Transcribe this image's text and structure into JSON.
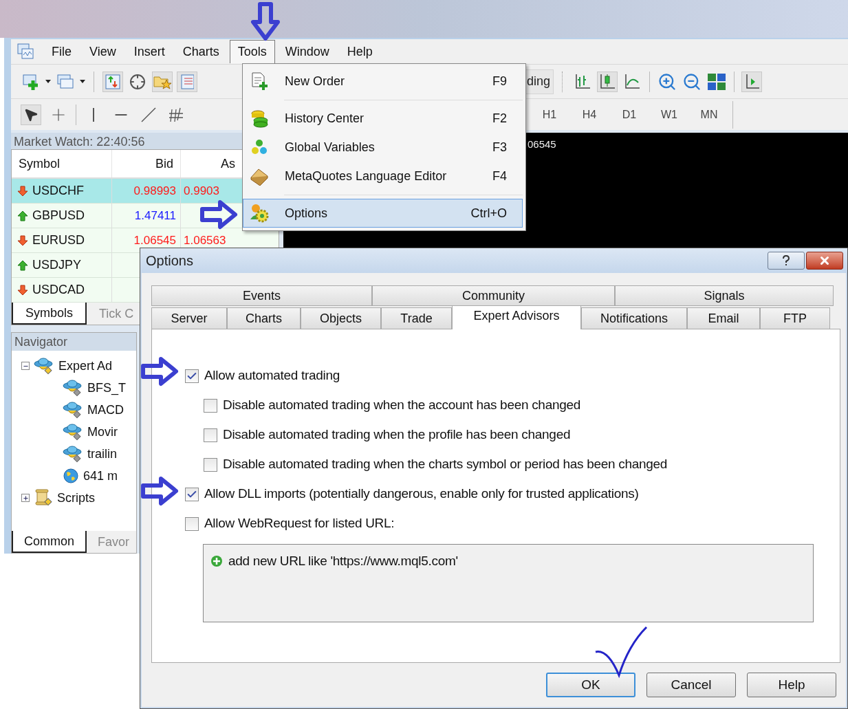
{
  "menu_bar": [
    {
      "label": "File",
      "selected": false
    },
    {
      "label": "View",
      "selected": false
    },
    {
      "label": "Insert",
      "selected": false
    },
    {
      "label": "Charts",
      "selected": false
    },
    {
      "label": "Tools",
      "selected": true
    },
    {
      "label": "Window",
      "selected": false
    },
    {
      "label": "Help",
      "selected": false
    }
  ],
  "tools_menu": [
    {
      "label": "New Order",
      "shortcut": "F9",
      "selected": false,
      "separator": true
    },
    {
      "label": "History Center",
      "shortcut": "F2",
      "selected": false,
      "separator": false
    },
    {
      "label": "Global Variables",
      "shortcut": "F3",
      "selected": false,
      "separator": false
    },
    {
      "label": "MetaQuotes Language Editor",
      "shortcut": "F4",
      "selected": false,
      "separator": true
    },
    {
      "label": "Options",
      "shortcut": "Ctrl+O",
      "selected": true,
      "separator": false
    }
  ],
  "toolbar": {
    "cut_button": "ding"
  },
  "timeframes": [
    "H1",
    "H4",
    "D1",
    "W1",
    "MN"
  ],
  "chart": {
    "price": "06545"
  },
  "market_watch": {
    "title": "Market Watch: 22:40:56",
    "columns": [
      "Symbol",
      "Bid",
      "As"
    ],
    "rows": [
      {
        "symbol": "USDCHF",
        "rising": false,
        "bid": "0.98993",
        "ask": "0.9903",
        "selected": true
      },
      {
        "symbol": "GBPUSD",
        "rising": true,
        "bid": "1.47411",
        "selected": false
      },
      {
        "symbol": "EURUSD",
        "rising": false,
        "bid": "1.06545",
        "ask": "1.06563",
        "selected": false
      },
      {
        "symbol": "USDJPY",
        "rising": true,
        "selected": false
      },
      {
        "symbol": "USDCAD",
        "rising": false,
        "selected": false
      }
    ],
    "tabs": [
      {
        "label": "Symbols",
        "selected": true
      },
      {
        "label": "Tick C",
        "selected": false
      }
    ]
  },
  "navigator": {
    "title": "Navigator",
    "tree": [
      {
        "label": "Expert Ad",
        "kind": "folder",
        "expanded": true,
        "children": [
          {
            "label": "BFS_T",
            "kind": "expert"
          },
          {
            "label": "MACD",
            "kind": "expert"
          },
          {
            "label": "Movir",
            "kind": "expert"
          },
          {
            "label": "trailin",
            "kind": "expert"
          },
          {
            "label": "641 m",
            "kind": "market"
          }
        ]
      },
      {
        "label": "Scripts",
        "kind": "scripts",
        "expanded": false
      }
    ],
    "tabs": [
      {
        "label": "Common",
        "selected": true
      },
      {
        "label": "Favor",
        "selected": false
      }
    ]
  },
  "dialog": {
    "title": "Options",
    "tab_rows": [
      [
        {
          "label": "Events",
          "selected": false
        },
        {
          "label": "Community",
          "selected": false
        },
        {
          "label": "Signals",
          "selected": false
        }
      ],
      [
        {
          "label": "Server",
          "selected": false
        },
        {
          "label": "Charts",
          "selected": false
        },
        {
          "label": "Objects",
          "selected": false
        },
        {
          "label": "Trade",
          "selected": false
        },
        {
          "label": "Expert Advisors",
          "selected": true
        },
        {
          "label": "Notifications",
          "selected": false
        },
        {
          "label": "Email",
          "selected": false
        },
        {
          "label": "FTP",
          "selected": false
        }
      ]
    ],
    "options": [
      {
        "label": "Allow automated trading",
        "kind": "main",
        "checked": true
      },
      {
        "label": "Disable automated trading when the account has been changed",
        "kind": "sub",
        "checked": false
      },
      {
        "label": "Disable automated trading when the profile has been changed",
        "kind": "sub",
        "checked": false
      },
      {
        "label": "Disable automated trading when the charts symbol or period has been changed",
        "kind": "sub",
        "checked": false
      },
      {
        "label": "Allow DLL imports (potentially dangerous, enable only for trusted applications)",
        "kind": "main",
        "checked": true
      },
      {
        "label": "Allow WebRequest for listed URL:",
        "kind": "main",
        "checked": false
      }
    ],
    "url_list": {
      "add_item": "add new URL like 'https://www.mql5.com'"
    },
    "buttons": [
      {
        "label": "OK",
        "selected": true
      },
      {
        "label": "Cancel",
        "selected": false
      },
      {
        "label": "Help",
        "selected": false
      }
    ]
  }
}
